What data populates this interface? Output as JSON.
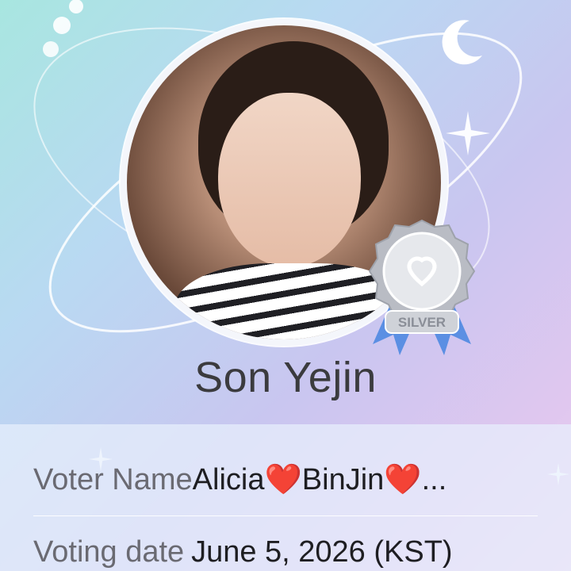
{
  "profile": {
    "name": "Son Yejin",
    "badge_text": "SILVER"
  },
  "vote": {
    "voter_label": "Voter Name",
    "voter_value": "Alicia❤️BinJin❤️...",
    "date_label": "Voting date",
    "date_value": "June 5, 2026 (KST)"
  },
  "colors": {
    "name_text": "#3b3b3e",
    "label_text": "#6a6a72",
    "value_text": "#1e1e22",
    "badge_silver": "#c9cbd1",
    "ribbon_blue": "#5b8fe3"
  },
  "icons": {
    "moon": "moon-icon",
    "stars": "sparkle-icon",
    "badge": "silver-badge-icon"
  }
}
